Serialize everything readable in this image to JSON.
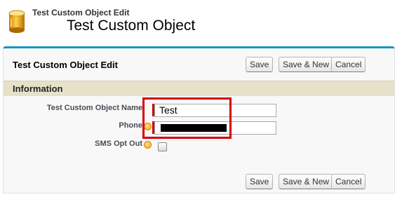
{
  "header": {
    "object_type": "Test Custom Object Edit",
    "record_title": "Test Custom Object",
    "icon": "database-cylinder-icon"
  },
  "panel": {
    "title": "Test Custom Object Edit",
    "buttons": {
      "save": "Save",
      "save_new": "Save & New",
      "cancel": "Cancel"
    }
  },
  "section": {
    "title": "Information"
  },
  "fields": {
    "name": {
      "label": "Test Custom Object Name",
      "value": "Test",
      "required": true
    },
    "phone": {
      "label": "Phone",
      "value_masked": true,
      "required": true,
      "help_icon": "info-icon"
    },
    "sms_opt_out": {
      "label": "SMS Opt Out",
      "checked": false,
      "help_icon": "info-icon"
    }
  },
  "colors": {
    "accent": "#1797c0",
    "section_bar": "#e6e2c9",
    "required": "#cc0000",
    "highlight": "#d50000"
  }
}
